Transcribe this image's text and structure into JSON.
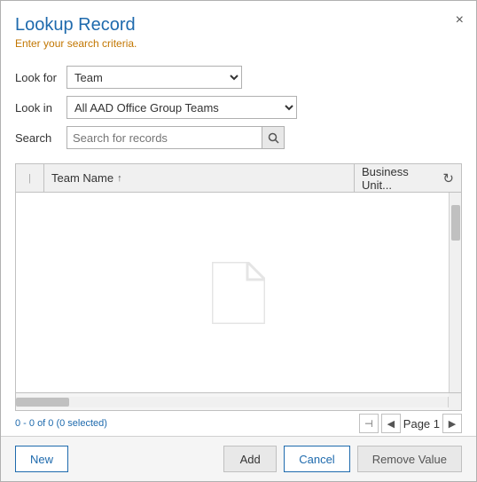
{
  "dialog": {
    "title": "Lookup Record",
    "subtitle": "Enter your search criteria.",
    "close_label": "×"
  },
  "form": {
    "look_for_label": "Look for",
    "look_in_label": "Look in",
    "search_label": "Search",
    "look_for_value": "Team",
    "look_in_value": "All AAD Office Group Teams",
    "look_for_options": [
      "Team"
    ],
    "look_in_options": [
      "All AAD Office Group Teams"
    ],
    "search_placeholder": "Search for records"
  },
  "grid": {
    "col_team_name": "Team Name",
    "sort_arrow": "↑",
    "col_business_unit": "Business Unit...",
    "refresh_icon": "↻"
  },
  "pagination": {
    "record_count": "0 - 0 of 0 (0 selected)",
    "page_label": "Page 1",
    "first_icon": "⊣",
    "prev_icon": "◀",
    "next_icon": "▶"
  },
  "buttons": {
    "new_label": "New",
    "add_label": "Add",
    "cancel_label": "Cancel",
    "remove_value_label": "Remove Value"
  }
}
